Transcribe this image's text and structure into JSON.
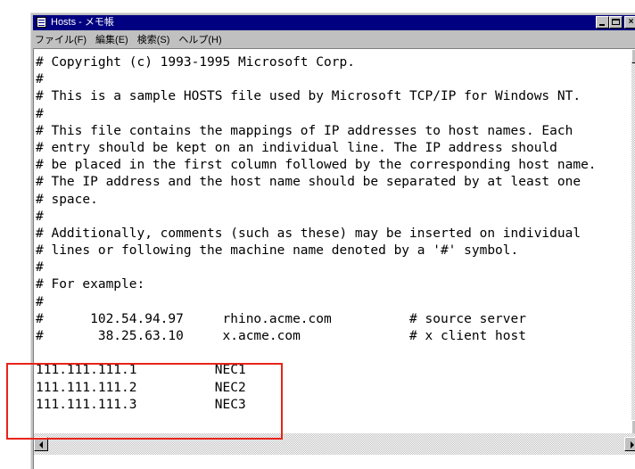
{
  "window": {
    "title": "Hosts - メモ帳",
    "menu": [
      "ファイル(F)",
      "編集(E)",
      "検索(S)",
      "ヘルプ(H)"
    ]
  },
  "document": {
    "lines": [
      "# Copyright (c) 1993-1995 Microsoft Corp.",
      "#",
      "# This is a sample HOSTS file used by Microsoft TCP/IP for Windows NT.",
      "#",
      "# This file contains the mappings of IP addresses to host names. Each",
      "# entry should be kept on an individual line. The IP address should",
      "# be placed in the first column followed by the corresponding host name.",
      "# The IP address and the host name should be separated by at least one",
      "# space.",
      "#",
      "# Additionally, comments (such as these) may be inserted on individual",
      "# lines or following the machine name denoted by a '#' symbol.",
      "#",
      "# For example:",
      "#",
      "#      102.54.94.97     rhino.acme.com          # source server",
      "#       38.25.63.10     x.acme.com              # x client host",
      "",
      "111.111.111.1          NEC1",
      "111.111.111.2          NEC2",
      "111.111.111.3          NEC3"
    ]
  },
  "annotation": {
    "color": "#e8231a"
  }
}
